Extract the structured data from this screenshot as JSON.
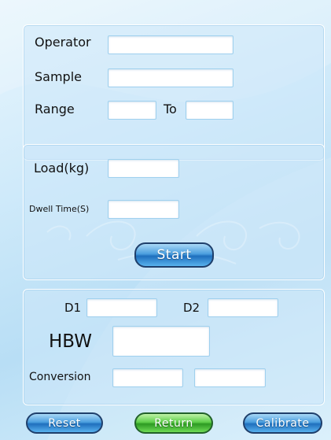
{
  "operator": {
    "label": "Operator",
    "value": ""
  },
  "sample": {
    "label": "Sample",
    "value": ""
  },
  "range": {
    "label": "Range",
    "to_label": "To",
    "from_value": "",
    "to_value": ""
  },
  "load": {
    "label": "Load(kg)",
    "value": ""
  },
  "dwell": {
    "label": "Dwell Time(S)",
    "value": ""
  },
  "start_label": "Start",
  "d1": {
    "label": "D1",
    "value": ""
  },
  "d2": {
    "label": "D2",
    "value": ""
  },
  "hbw": {
    "label": "HBW",
    "value": ""
  },
  "conversion": {
    "label": "Conversion",
    "value1": "",
    "value2": ""
  },
  "buttons": {
    "reset": "Reset",
    "return": "Return",
    "calibrate": "Calibrate"
  },
  "colors": {
    "primary_button": "#2a7fcf",
    "return_button": "#3cb52e",
    "field_border": "#9fd0ee"
  }
}
